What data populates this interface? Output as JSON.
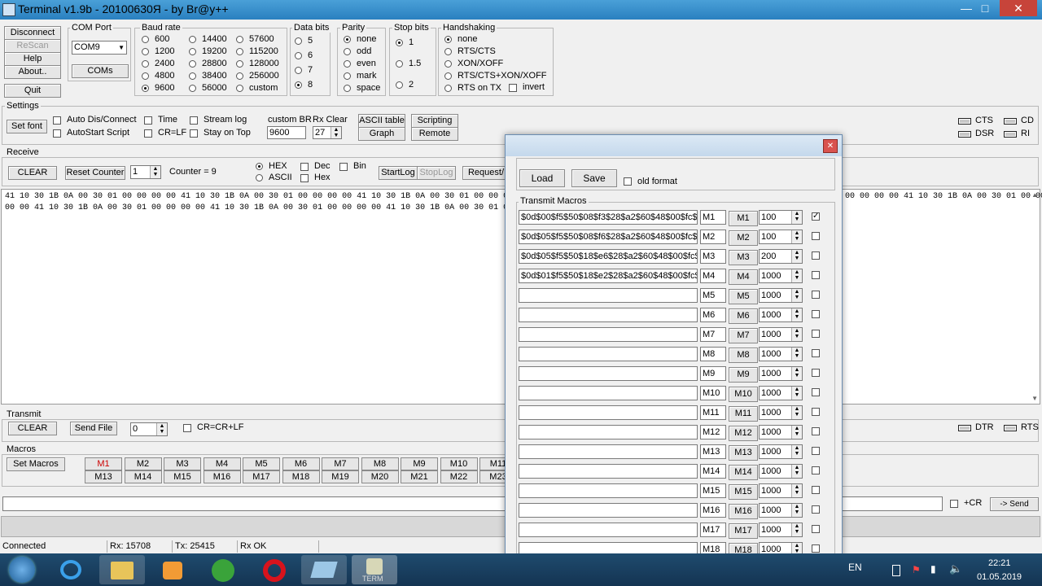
{
  "window": {
    "title": "Terminal v1.9b - 20100630Я - by Br@y++",
    "min": "—",
    "max": "□",
    "close": "✕"
  },
  "conn_buttons": {
    "disconnect": "Disconnect",
    "rescan": "ReScan",
    "help": "Help",
    "about": "About..",
    "quit": "Quit"
  },
  "com_port": {
    "label": "COM Port",
    "value": "COM9",
    "coms": "COMs"
  },
  "baud": {
    "label": "Baud rate",
    "options": [
      "600",
      "1200",
      "2400",
      "4800",
      "9600",
      "14400",
      "19200",
      "28800",
      "38400",
      "56000",
      "57600",
      "115200",
      "128000",
      "256000",
      "custom"
    ],
    "selected": "9600"
  },
  "data_bits": {
    "label": "Data bits",
    "options": [
      "5",
      "6",
      "7",
      "8"
    ],
    "selected": "8"
  },
  "parity": {
    "label": "Parity",
    "options": [
      "none",
      "odd",
      "even",
      "mark",
      "space"
    ],
    "selected": "none"
  },
  "stop_bits": {
    "label": "Stop bits",
    "options": [
      "1",
      "1.5",
      "2"
    ],
    "selected": "1"
  },
  "handshaking": {
    "label": "Handshaking",
    "options": [
      "none",
      "RTS/CTS",
      "XON/XOFF",
      "RTS/CTS+XON/XOFF",
      "RTS on TX"
    ],
    "selected": "none",
    "invert": "invert"
  },
  "settings": {
    "label": "Settings",
    "set_font": "Set font",
    "auto_dis": "Auto Dis/Connect",
    "autostart": "AutoStart Script",
    "time": "Time",
    "crlf": "CR=LF",
    "stream_log": "Stream log",
    "stay_on_top": "Stay on Top",
    "custom_br_label": "custom BR",
    "custom_br": "9600",
    "rx_clear_label": "Rx Clear",
    "rx_clear": "27",
    "ascii_table": "ASCII table",
    "graph": "Graph",
    "scripting": "Scripting",
    "remote": "Remote"
  },
  "leds": {
    "cts": "CTS",
    "cd": "CD",
    "dsr": "DSR",
    "ri": "RI",
    "dtr": "DTR",
    "rts": "RTS"
  },
  "receive": {
    "label": "Receive",
    "clear": "CLEAR",
    "reset_counter": "Reset Counter",
    "counter_spin": "1",
    "counter": "Counter = 9",
    "hex": "HEX",
    "ascii": "ASCII",
    "dec": "Dec",
    "hex2": "Hex",
    "bin": "Bin",
    "startlog": "StartLog",
    "stoplog": "StopLog",
    "request": "Request/",
    "line1a": "41 10 30 1B 0A 00 30 01 00 00 00 00 41 10 30 1B 0A 00 30 01 00 00 00 00 41 10 30 1B 0A 00 30 01 00 00 00 00 41 10 30 1B",
    "line1b": "00 00 00 00 41 10 30 1B 0A 00 30 01 00 00",
    "line2": "00 00 41 10 30 1B 0A 00 30 01 00 00 00 00 41 10 30 1B 0A 00 30 01 00 00 00 00 41 10 30 1B 0A 00 30 01 00 00 00 00"
  },
  "transmit": {
    "label": "Transmit",
    "clear": "CLEAR",
    "send_file": "Send File",
    "spin": "0",
    "crcrlf": "CR=CR+LF",
    "plus_cr": "+CR",
    "send": "-> Send"
  },
  "macros": {
    "label": "Macros",
    "set_macros": "Set Macros",
    "row1": [
      "M1",
      "M2",
      "M3",
      "M4",
      "M5",
      "M6",
      "M7",
      "M8",
      "M9",
      "M10",
      "M11"
    ],
    "row2": [
      "M13",
      "M14",
      "M15",
      "M16",
      "M17",
      "M18",
      "M19",
      "M20",
      "M21",
      "M22",
      "M23"
    ]
  },
  "status": {
    "connected": "Connected",
    "rx": "Rx: 15708",
    "tx": "Tx: 25415",
    "rxok": "Rx OK"
  },
  "dialog": {
    "close": "✕",
    "load": "Load",
    "save": "Save",
    "old_format": "old format",
    "transmit_macros": "Transmit Macros",
    "rows": [
      {
        "text": "$0d$00$f5$50$08$f3$28$a2$60$48$00$fc$",
        "name": "M1",
        "btn": "M1",
        "delay": "100",
        "checked": true
      },
      {
        "text": "$0d$05$f5$50$08$f6$28$a2$60$48$00$fc$",
        "name": "M2",
        "btn": "M2",
        "delay": "100",
        "checked": false
      },
      {
        "text": "$0d$05$f5$50$18$e6$28$a2$60$48$00$fc$",
        "name": "M3",
        "btn": "M3",
        "delay": "200",
        "checked": false
      },
      {
        "text": "$0d$01$f5$50$18$e2$28$a2$60$48$00$fc$",
        "name": "M4",
        "btn": "M4",
        "delay": "1000",
        "checked": false
      },
      {
        "text": "",
        "name": "M5",
        "btn": "M5",
        "delay": "1000",
        "checked": false
      },
      {
        "text": "",
        "name": "M6",
        "btn": "M6",
        "delay": "1000",
        "checked": false
      },
      {
        "text": "",
        "name": "M7",
        "btn": "M7",
        "delay": "1000",
        "checked": false
      },
      {
        "text": "",
        "name": "M8",
        "btn": "M8",
        "delay": "1000",
        "checked": false
      },
      {
        "text": "",
        "name": "M9",
        "btn": "M9",
        "delay": "1000",
        "checked": false
      },
      {
        "text": "",
        "name": "M10",
        "btn": "M10",
        "delay": "1000",
        "checked": false
      },
      {
        "text": "",
        "name": "M11",
        "btn": "M11",
        "delay": "1000",
        "checked": false
      },
      {
        "text": "",
        "name": "M12",
        "btn": "M12",
        "delay": "1000",
        "checked": false
      },
      {
        "text": "",
        "name": "M13",
        "btn": "M13",
        "delay": "1000",
        "checked": false
      },
      {
        "text": "",
        "name": "M14",
        "btn": "M14",
        "delay": "1000",
        "checked": false
      },
      {
        "text": "",
        "name": "M15",
        "btn": "M15",
        "delay": "1000",
        "checked": false
      },
      {
        "text": "",
        "name": "M16",
        "btn": "M16",
        "delay": "1000",
        "checked": false
      },
      {
        "text": "",
        "name": "M17",
        "btn": "M17",
        "delay": "1000",
        "checked": false
      },
      {
        "text": "",
        "name": "M18",
        "btn": "M18",
        "delay": "1000",
        "checked": false
      }
    ]
  },
  "taskbar": {
    "lang": "EN",
    "time": "22:21",
    "date": "01.05.2019",
    "term_label": "TERM"
  }
}
